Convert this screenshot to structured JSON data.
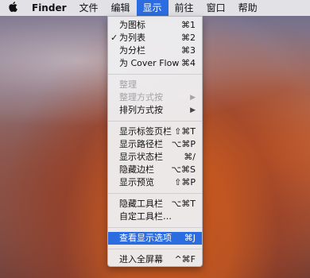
{
  "menubar": {
    "apple_icon": "apple-logo-icon",
    "items": [
      "Finder",
      "文件",
      "编辑",
      "显示",
      "前往",
      "窗口",
      "帮助"
    ]
  },
  "menu": {
    "group1": [
      {
        "label": "为图标",
        "shortcut": "⌘1"
      },
      {
        "label": "为列表",
        "shortcut": "⌘2",
        "checked": "✓"
      },
      {
        "label": "为分栏",
        "shortcut": "⌘3"
      },
      {
        "label": "为 Cover Flow",
        "shortcut": "⌘4"
      }
    ],
    "group2": [
      {
        "label": "整理",
        "disabled": true
      },
      {
        "label": "整理方式按",
        "disabled": true,
        "arrow": "▶"
      },
      {
        "label": "排列方式按",
        "arrow": "▶"
      }
    ],
    "group3": [
      {
        "label": "显示标签页栏",
        "shortcut": "⇧⌘T"
      },
      {
        "label": "显示路径栏",
        "shortcut": "⌥⌘P"
      },
      {
        "label": "显示状态栏",
        "shortcut": "⌘/"
      },
      {
        "label": "隐藏边栏",
        "shortcut": "⌥⌘S"
      },
      {
        "label": "显示预览",
        "shortcut": "⇧⌘P"
      }
    ],
    "group4": [
      {
        "label": "隐藏工具栏",
        "shortcut": "⌥⌘T"
      },
      {
        "label": "自定工具栏…"
      }
    ],
    "group5": [
      {
        "label": "查看显示选项",
        "shortcut": "⌘J"
      }
    ],
    "group6": [
      {
        "label": "进入全屏幕",
        "shortcut": "^⌘F"
      }
    ]
  },
  "colors": {
    "highlight": "#2b6de0"
  }
}
